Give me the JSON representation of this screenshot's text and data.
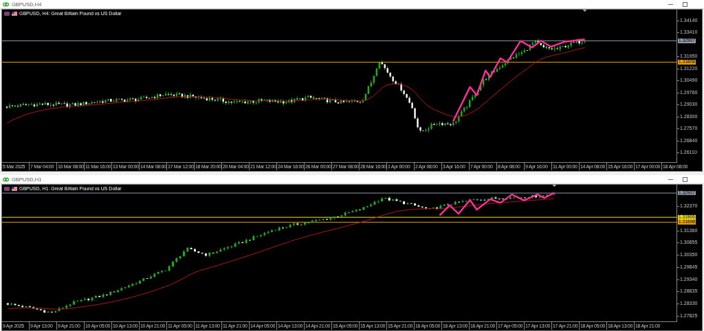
{
  "windows": [
    {
      "title": "GBPUSD,H4",
      "chart_label": "GBPUSD, H4:  Great Britain Pound vs US Dollar",
      "price_labels": [
        "1.34140",
        "1.33410",
        "1.31950",
        "1.31220",
        "1.30490",
        "1.29760",
        "1.29030",
        "1.28300",
        "1.27570",
        "1.26840",
        "1.26110"
      ],
      "price_tags": [
        {
          "text": "1.32907",
          "color": "#8e9aa8"
        },
        {
          "text": "1.31608",
          "color": "#f0a000"
        }
      ],
      "time_labels": [
        "5 Mar 2025",
        "7 Mar 04:00",
        "10 Mar 08:00",
        "11 Mar 16:00",
        "13 Mar 00:00",
        "14 Mar 08:00",
        "17 Mar 12:00",
        "18 Mar 20:00",
        "20 Mar 04:00",
        "21 Mar 12:00",
        "24 Mar 16:00",
        "26 Mar 00:00",
        "27 Mar 08:00",
        "28 Mar 16:00",
        "1 Apr 00:00",
        "2 Apr 08:00",
        "3 Apr 16:00",
        "7 Apr 00:00",
        "8 Apr 08:00",
        "9 Apr 16:00",
        "11 Apr 00:00",
        "14 Apr 08:00",
        "15 Apr 16:00",
        "17 Apr 00:00",
        "18 Apr 08:00"
      ]
    },
    {
      "title": "GBPUSD,H1",
      "chart_label": "GBPUSD, H1:  Great Britain Pound vs US Dollar",
      "price_labels": [
        "1.32370",
        "1.31360",
        "1.30855",
        "1.30350",
        "1.29845",
        "1.29340",
        "1.28835",
        "1.28330",
        "1.27825"
      ],
      "price_tags": [
        {
          "text": "1.32907",
          "color": "#8e9aa8"
        },
        {
          "text": "1.31906",
          "color": "#e8e000"
        },
        {
          "text": "1.31698",
          "color": "#f0a000"
        }
      ],
      "time_labels": [
        "9 Apr 2025",
        "9 Apr 13:00",
        "9 Apr 21:00",
        "10 Apr 05:00",
        "10 Apr 13:00",
        "10 Apr 21:00",
        "11 Apr 05:00",
        "11 Apr 13:00",
        "11 Apr 21:00",
        "14 Apr 05:00",
        "14 Apr 13:00",
        "14 Apr 21:00",
        "15 Apr 05:00",
        "15 Apr 13:00",
        "15 Apr 21:00",
        "16 Apr 05:00",
        "16 Apr 13:00",
        "16 Apr 21:00",
        "17 Apr 05:00",
        "17 Apr 13:00",
        "17 Apr 21:00",
        "18 Apr 05:00",
        "18 Apr 13:00",
        "18 Apr 21:00"
      ]
    }
  ]
}
